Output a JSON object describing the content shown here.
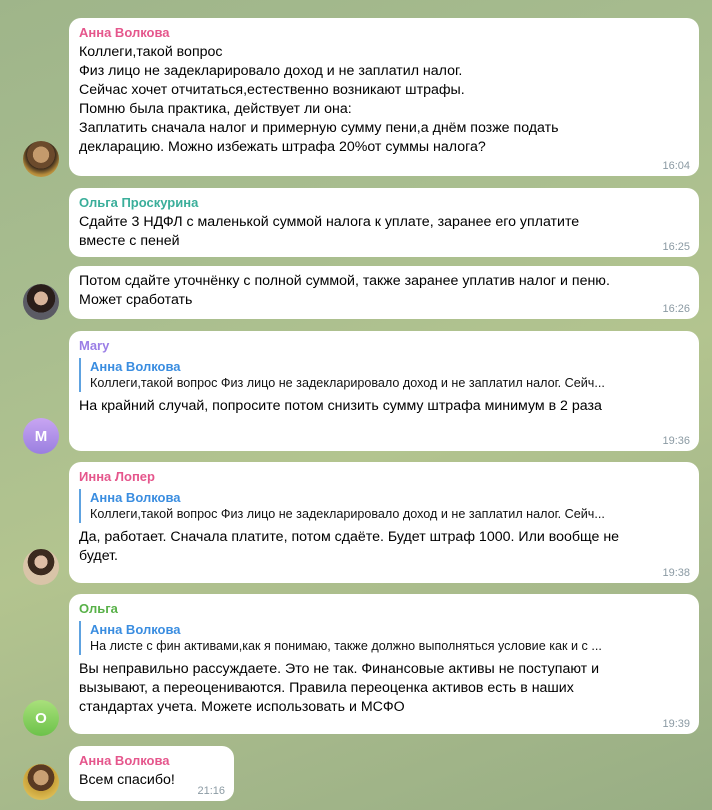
{
  "colors": {
    "anna": "#e5568c",
    "olga_p": "#3aae9a",
    "mary": "#9b7ee6",
    "inna": "#e5568c",
    "olga": "#58b148",
    "reply_accent": "#3a8de0"
  },
  "messages": [
    {
      "sender": "Анна Волкова",
      "text": "Коллеги,такой вопрос\nФиз лицо не задекларировало доход и не заплатил налог.\nСейчас хочет отчитаться,естественно возникают штрафы.\nПомню была практика, действует ли она:\nЗаплатить сначала налог и примерную сумму пени,а днём позже подать\nдекларацию. Можно избежать штрафа 20%от суммы налога?",
      "time": "16:04"
    },
    {
      "sender": "Ольга Проскурина",
      "text": "Сдайте 3 НДФЛ с маленькой суммой налога к уплате, заранее его уплатите\nвместе с пеней",
      "time": "16:25"
    },
    {
      "text": "Потом сдайте уточнёнку с полной суммой, также заранее уплатив налог и пеню.\nМожет сработать",
      "time": "16:26"
    },
    {
      "sender": "Mary",
      "avatar_letter": "M",
      "reply_name": "Анна Волкова",
      "reply_text": "Коллеги,такой вопрос Физ лицо не задекларировало доход и не заплатил налог. Сейч...",
      "text": "На крайний случай, попросите потом снизить сумму штрафа минимум в 2 раза",
      "time": "19:36"
    },
    {
      "sender": "Инна Лопер",
      "reply_name": "Анна Волкова",
      "reply_text": "Коллеги,такой вопрос Физ лицо не задекларировало доход и не заплатил налог. Сейч...",
      "text": "Да, работает. Сначала платите, потом сдаёте. Будет штраф 1000. Или вообще не\nбудет.",
      "time": "19:38"
    },
    {
      "sender": "Ольга",
      "avatar_letter": "О",
      "reply_name": "Анна Волкова",
      "reply_text": "На листе с фин активами,как я понимаю, также должно выполняться условие как и с ...",
      "text": "Вы неправильно рассуждаете. Это не так. Финансовые активы не поступают и\nвызывают, а переоцениваются. Правила переоценка активов есть в наших\nстандартах учета. Можете использовать и МСФО",
      "time": "19:39"
    },
    {
      "sender": "Анна Волкова",
      "text": "Всем спасибо!",
      "time": "21:16"
    }
  ]
}
